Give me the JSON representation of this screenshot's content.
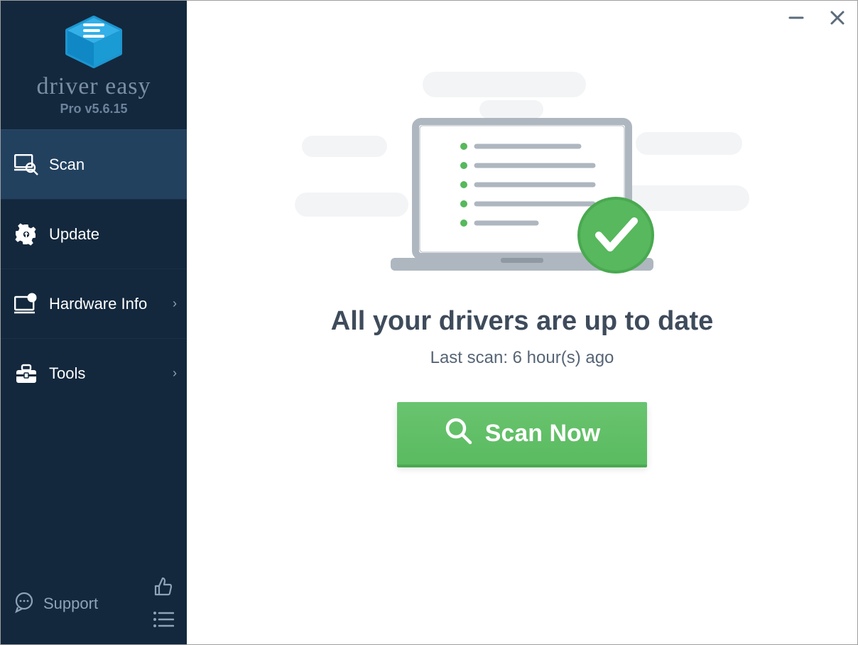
{
  "brand": {
    "name": "driver easy",
    "version_label": "Pro v5.6.15"
  },
  "sidebar": {
    "items": [
      {
        "label": "Scan",
        "active": true,
        "has_chevron": false
      },
      {
        "label": "Update",
        "active": false,
        "has_chevron": false
      },
      {
        "label": "Hardware Info",
        "active": false,
        "has_chevron": true
      },
      {
        "label": "Tools",
        "active": false,
        "has_chevron": true
      }
    ],
    "support_label": "Support"
  },
  "main": {
    "headline": "All your drivers are up to date",
    "last_scan_label": "Last scan: 6 hour(s) ago",
    "scan_button_label": "Scan Now"
  },
  "colors": {
    "sidebar_bg": "#13283d",
    "sidebar_active": "#22415f",
    "accent_green": "#5cbb62",
    "logo_light": "#33b0e8",
    "logo_dark": "#1088c6"
  }
}
